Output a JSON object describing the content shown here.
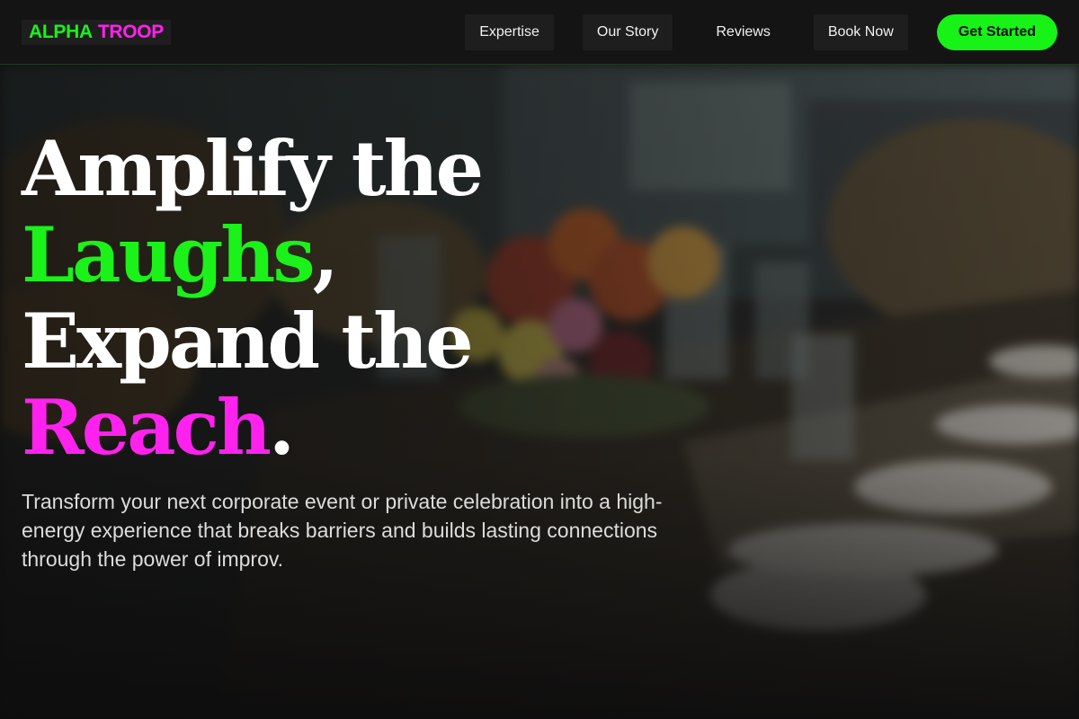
{
  "brand": {
    "word1": "ALPHA",
    "word2": "TROOP"
  },
  "nav": {
    "links": [
      {
        "label": "Expertise"
      },
      {
        "label": "Our Story"
      },
      {
        "label": "Reviews"
      },
      {
        "label": "Book Now"
      }
    ],
    "cta_label": "Get Started"
  },
  "hero": {
    "line1": "Amplify the",
    "line2_word": "Laughs",
    "line2_punct": ",",
    "line3": "Expand the",
    "line4_word": "Reach",
    "line4_punct": ".",
    "subtext": "Transform your next corporate event or private celebration into a high-energy experience that breaks barriers and builds lasting connections through the power of improv."
  },
  "colors": {
    "accent_green": "#1af21a",
    "accent_magenta": "#ff22ee",
    "background": "#111111"
  }
}
